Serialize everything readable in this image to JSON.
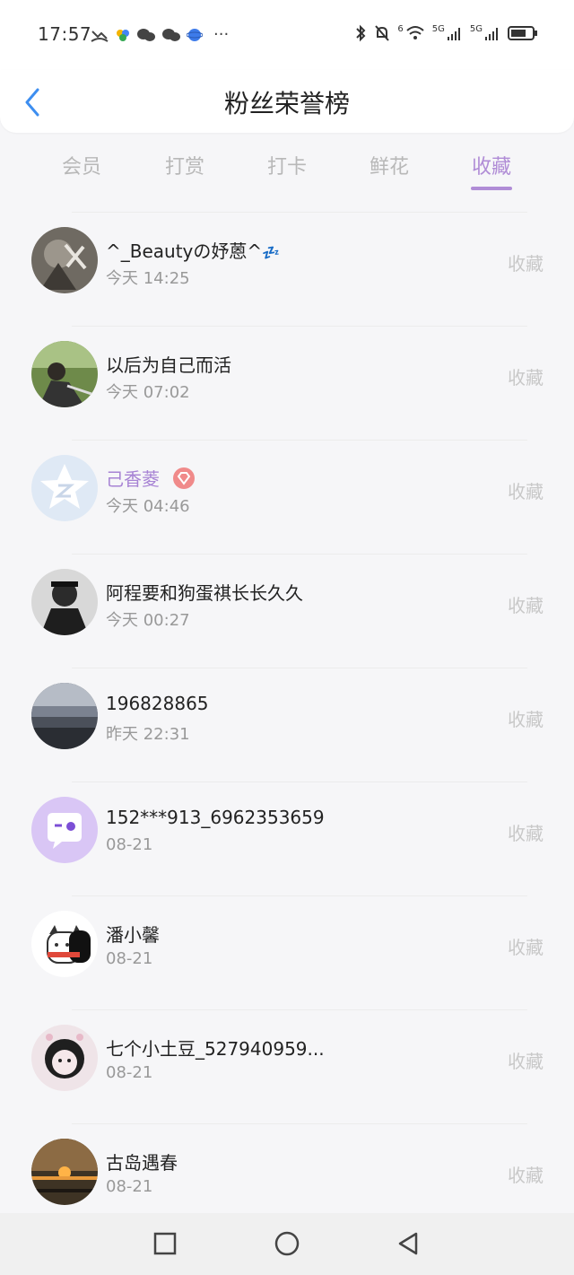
{
  "status_bar": {
    "time": "17:57",
    "ellipsis": "···",
    "net_label_1": "5G",
    "net_label_2": "5G",
    "wifi_label": "6"
  },
  "header": {
    "title": "粉丝荣誉榜",
    "back_icon": "chevron-left-icon"
  },
  "tabs": [
    {
      "label": "会员"
    },
    {
      "label": "打赏"
    },
    {
      "label": "打卡"
    },
    {
      "label": "鲜花"
    },
    {
      "label": "收藏"
    }
  ],
  "active_tab": "收藏",
  "accent_color": "#b08cd6",
  "rows": [
    {
      "name": "^_Beautyの妤蒽^",
      "suffix": "💤",
      "time": "今天 14:25",
      "action": "收藏"
    },
    {
      "name": "以后为自己而活",
      "time": "今天 07:02",
      "action": "收藏"
    },
    {
      "name": "己香菱",
      "time": "今天 04:46",
      "action": "收藏"
    },
    {
      "name": "阿程要和狗蛋祺长长久久",
      "time": "今天 00:27",
      "action": "收藏"
    },
    {
      "name": "196828865",
      "time": "昨天 22:31",
      "action": "收藏"
    },
    {
      "name": "152***913_6962353659",
      "time": "08-21",
      "action": "收藏"
    },
    {
      "name": "潘小馨",
      "time": "08-21",
      "action": "收藏"
    },
    {
      "name": "七个小土豆_527940959...",
      "time": "08-21",
      "action": "收藏"
    },
    {
      "name": "古岛遇春",
      "time": "08-21",
      "action": "收藏"
    }
  ],
  "nav": {
    "square": "recent-apps-icon",
    "circle": "home-icon",
    "triangle": "back-icon"
  }
}
